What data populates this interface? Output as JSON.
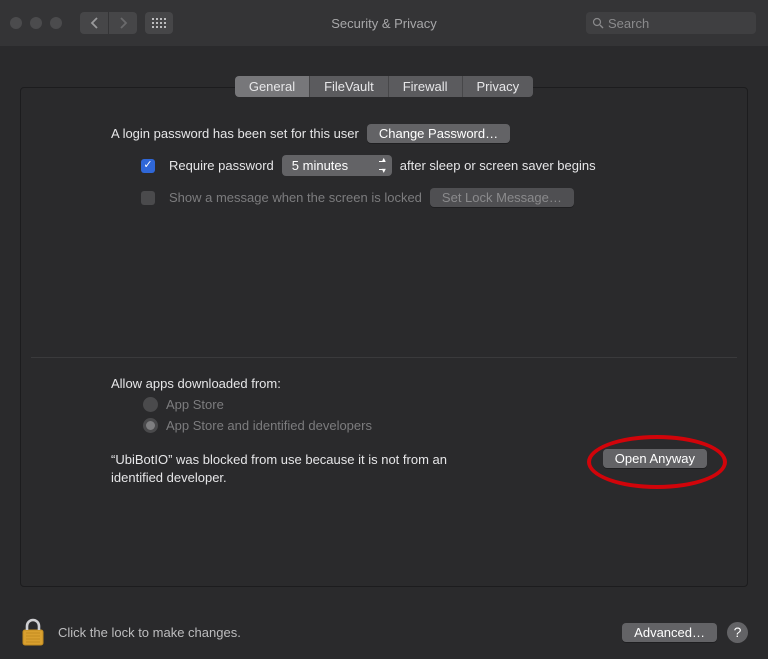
{
  "window": {
    "title": "Security & Privacy",
    "search_placeholder": "Search"
  },
  "tabs": {
    "general": "General",
    "filevault": "FileVault",
    "firewall": "Firewall",
    "privacy": "Privacy"
  },
  "login": {
    "set_text": "A login password has been set for this user",
    "change_btn": "Change Password…",
    "require_label": "Require password",
    "delay_value": "5 minutes",
    "after_text": "after sleep or screen saver begins",
    "show_msg_label": "Show a message when the screen is locked",
    "set_lock_btn": "Set Lock Message…"
  },
  "apps": {
    "heading": "Allow apps downloaded from:",
    "opt1": "App Store",
    "opt2": "App Store and identified developers",
    "blocked_msg": "“UbiBotIO” was blocked from use because it is not from an identified developer.",
    "open_btn": "Open Anyway"
  },
  "footer": {
    "lock_text": "Click the lock to make changes.",
    "advanced_btn": "Advanced…",
    "help": "?"
  }
}
